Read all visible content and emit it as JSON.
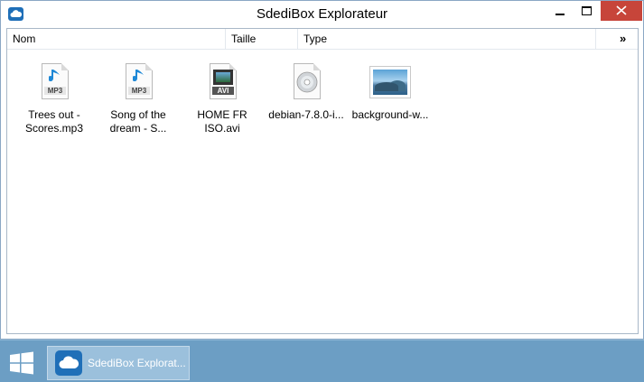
{
  "window": {
    "title": "SdediBox Explorateur"
  },
  "columns": {
    "name": "Nom",
    "size": "Taille",
    "type": "Type",
    "more": "»"
  },
  "files": [
    {
      "label": "Trees out -\nScores.mp3",
      "icon": "mp3-file-icon",
      "ext": "MP3"
    },
    {
      "label": "Song of the\ndream - S...",
      "icon": "mp3-file-icon",
      "ext": "MP3"
    },
    {
      "label": "HOME FR\nISO.avi",
      "icon": "video-file-icon",
      "ext": "AVI"
    },
    {
      "label": "debian-7.8.0-i...",
      "icon": "disc-image-icon",
      "ext": ""
    },
    {
      "label": "background-w...",
      "icon": "image-file-icon",
      "ext": ""
    }
  ],
  "taskbar": {
    "app_label": "SdediBox Explorat..."
  },
  "colors": {
    "accent": "#1f6fb8",
    "close": "#c7453a",
    "taskbar": "#6c9ec4"
  }
}
